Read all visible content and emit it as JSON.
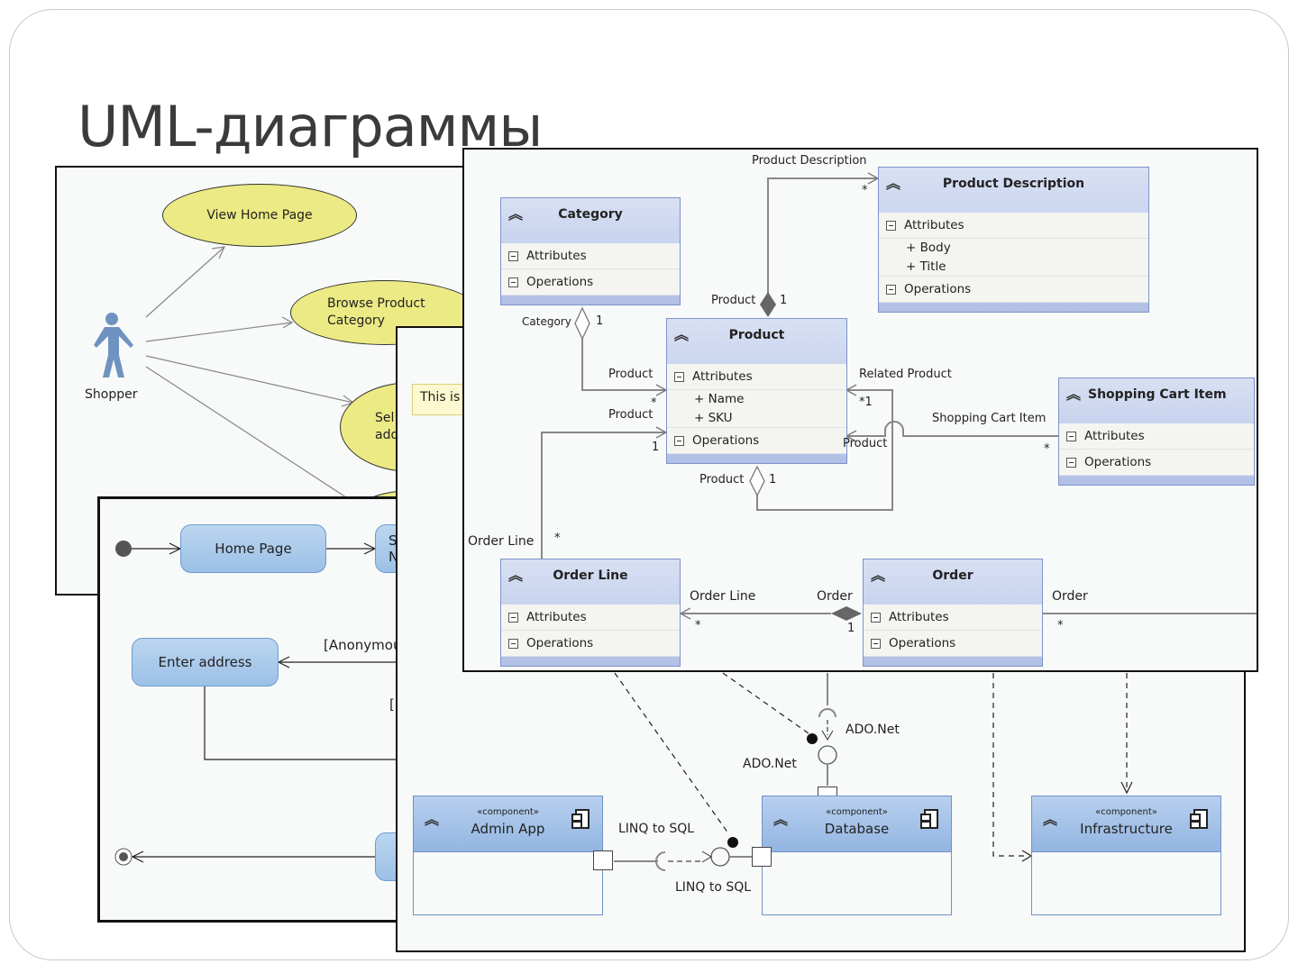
{
  "slide": {
    "title": "UML-диаграммы"
  },
  "use_case": {
    "actor": "Shopper",
    "cases": [
      {
        "line1": "View Home Page",
        "line2": ""
      },
      {
        "line1": "Browse Product",
        "line2": "Category"
      },
      {
        "line1": "Sel",
        "line2": "add"
      },
      {
        "line1": "",
        "line2": ""
      }
    ],
    "colors": {
      "case_fill": "#ecea84",
      "actor": "#6f93c0"
    }
  },
  "activity": {
    "states": [
      "Home Page",
      "S\nN",
      "Enter address",
      ""
    ],
    "guards": [
      "[Anonymou",
      "["
    ],
    "colors": {
      "state_fill": "#a9c8ea"
    }
  },
  "component": {
    "note": "This is",
    "stereotype": "«component»",
    "components": [
      "Admin App",
      "Database",
      "Infrastructure"
    ],
    "interfaces": {
      "ado_top": "ADO.Net",
      "ado_bottom": "ADO.Net",
      "linq_top": "LINQ to SQL",
      "linq_bottom": "LINQ to SQL"
    }
  },
  "class_diagram": {
    "compartments": {
      "attributes": "Attributes",
      "operations": "Operations"
    },
    "classes": {
      "category": {
        "name": "Category",
        "attributes": []
      },
      "product_description": {
        "name": "Product Description",
        "attributes": [
          "+ Body",
          "+ Title"
        ]
      },
      "product": {
        "name": "Product",
        "attributes": [
          "+ Name",
          "+ SKU"
        ]
      },
      "shopping_cart_item": {
        "name": "Shopping Cart Item",
        "attributes": []
      },
      "order_line": {
        "name": "Order Line",
        "attributes": []
      },
      "order": {
        "name": "Order",
        "attributes": []
      }
    },
    "roles": {
      "pd_role": "Product Description",
      "pd_mult": "*",
      "pd_product": "Product",
      "pd_product_mult": "1",
      "cat_role": "Category",
      "cat_mult": "1",
      "cat_product": "Product",
      "cat_product_mult": "*",
      "ol_product": "Product",
      "ol_product_mult": "1",
      "related": "Related Product",
      "related_mult": "*1",
      "sci_role": "Shopping Cart Item",
      "sci_product": "Product",
      "sci_mult": "*",
      "self_product": "Product",
      "self_mult": "1",
      "ol_role": "Order Line",
      "ol_mult": "*",
      "order_ol": "Order Line",
      "order_ol_mult": "*",
      "order_role": "Order",
      "order_mult": "1",
      "order_right": "Order",
      "order_right_mult": "*"
    }
  }
}
